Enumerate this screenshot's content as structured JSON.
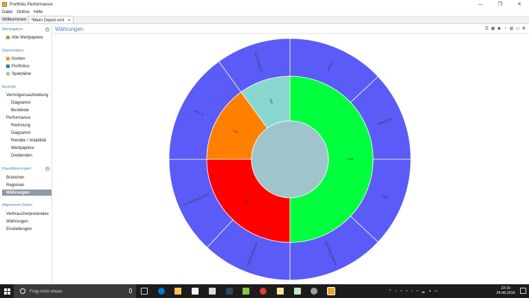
{
  "window": {
    "title": "Portfolio Performance",
    "controls": [
      "—",
      "❐",
      "✕"
    ]
  },
  "menu": [
    "Datei",
    "Online",
    "Hilfe"
  ],
  "tabs": [
    {
      "label": "Willkommen",
      "close": ""
    },
    {
      "label": "*Mein Depot.xml",
      "close": "✕"
    }
  ],
  "sidebar": {
    "sections": [
      {
        "title": "Wertpapiere",
        "items": [
          {
            "label": "Alle Wertpapiere",
            "icon": "#7ab648"
          }
        ]
      },
      {
        "title": "Stammdaten",
        "items": [
          {
            "label": "Konten",
            "icon": "#e8962e"
          },
          {
            "label": "Portfolios",
            "icon": "#3c6fb0"
          },
          {
            "label": "Sparpläne",
            "icon": "#b8b8b8"
          }
        ]
      },
      {
        "title": "Berichte",
        "items": [
          {
            "label": "Vermögensaufstellung"
          },
          {
            "label": "Diagramm"
          },
          {
            "label": "Bestände"
          },
          {
            "label": "Performance"
          },
          {
            "label": "Rechnung"
          },
          {
            "label": "Diagramm"
          },
          {
            "label": "Rendite / Volatilität"
          },
          {
            "label": "Wertpapiere"
          },
          {
            "label": "Dividenden"
          }
        ]
      },
      {
        "title": "Klassifizierungen",
        "items": [
          {
            "label": "Branchen"
          },
          {
            "label": "Regionen"
          },
          {
            "label": "Währungen"
          }
        ]
      },
      {
        "title": "Allgemeine Daten",
        "items": [
          {
            "label": "Verbraucherpreisindex"
          },
          {
            "label": "Währungen"
          },
          {
            "label": "Einstellungen"
          }
        ]
      }
    ]
  },
  "main": {
    "title": "Währungen",
    "toolbar_icons": [
      "list-view-icon",
      "table-view-icon",
      "sunburst-view-icon",
      "pie-view-icon",
      "bar-view-icon",
      "folder-icon",
      "settings-icon"
    ]
  },
  "chart_data": {
    "type": "pie",
    "variant": "sunburst",
    "colors": {
      "outer": "#5b5bf7",
      "center": "#9ec4cc",
      "EUR": "#00ff3c",
      "USD": "#ff0000",
      "CHF": "#ff8000",
      "DKK": "#88d8d0"
    },
    "inner_ring": [
      {
        "label": "EUR",
        "share": 0.5
      },
      {
        "label": "USD",
        "share": 0.25
      },
      {
        "label": "CHF",
        "share": 0.15
      },
      {
        "label": "DKK",
        "share": 0.1
      }
    ],
    "outer_ring": [
      {
        "label": "BASF N",
        "share": 0.13,
        "parent": "EUR"
      },
      {
        "label": "DAIMLER N",
        "share": 0.12,
        "parent": "EUR"
      },
      {
        "label": "DAIMI",
        "share": 0.12,
        "parent": "EUR"
      },
      {
        "label": "DEUTSCHE BANK N",
        "share": 0.13,
        "parent": "EUR"
      },
      {
        "label": "GILEAD SCIENCES",
        "share": 0.12,
        "parent": "USD"
      },
      {
        "label": "The Walt Disney Comp",
        "share": 0.13,
        "parent": "USD"
      },
      {
        "label": "BVD - B",
        "share": 0.15,
        "parent": "CHF"
      },
      {
        "label": "Novo Nordisk A/S",
        "share": 0.1,
        "parent": "DKK"
      }
    ]
  },
  "taskbar": {
    "search_placeholder": "Frag mich etwas",
    "time": "22:15",
    "date": "24.08.2016"
  }
}
